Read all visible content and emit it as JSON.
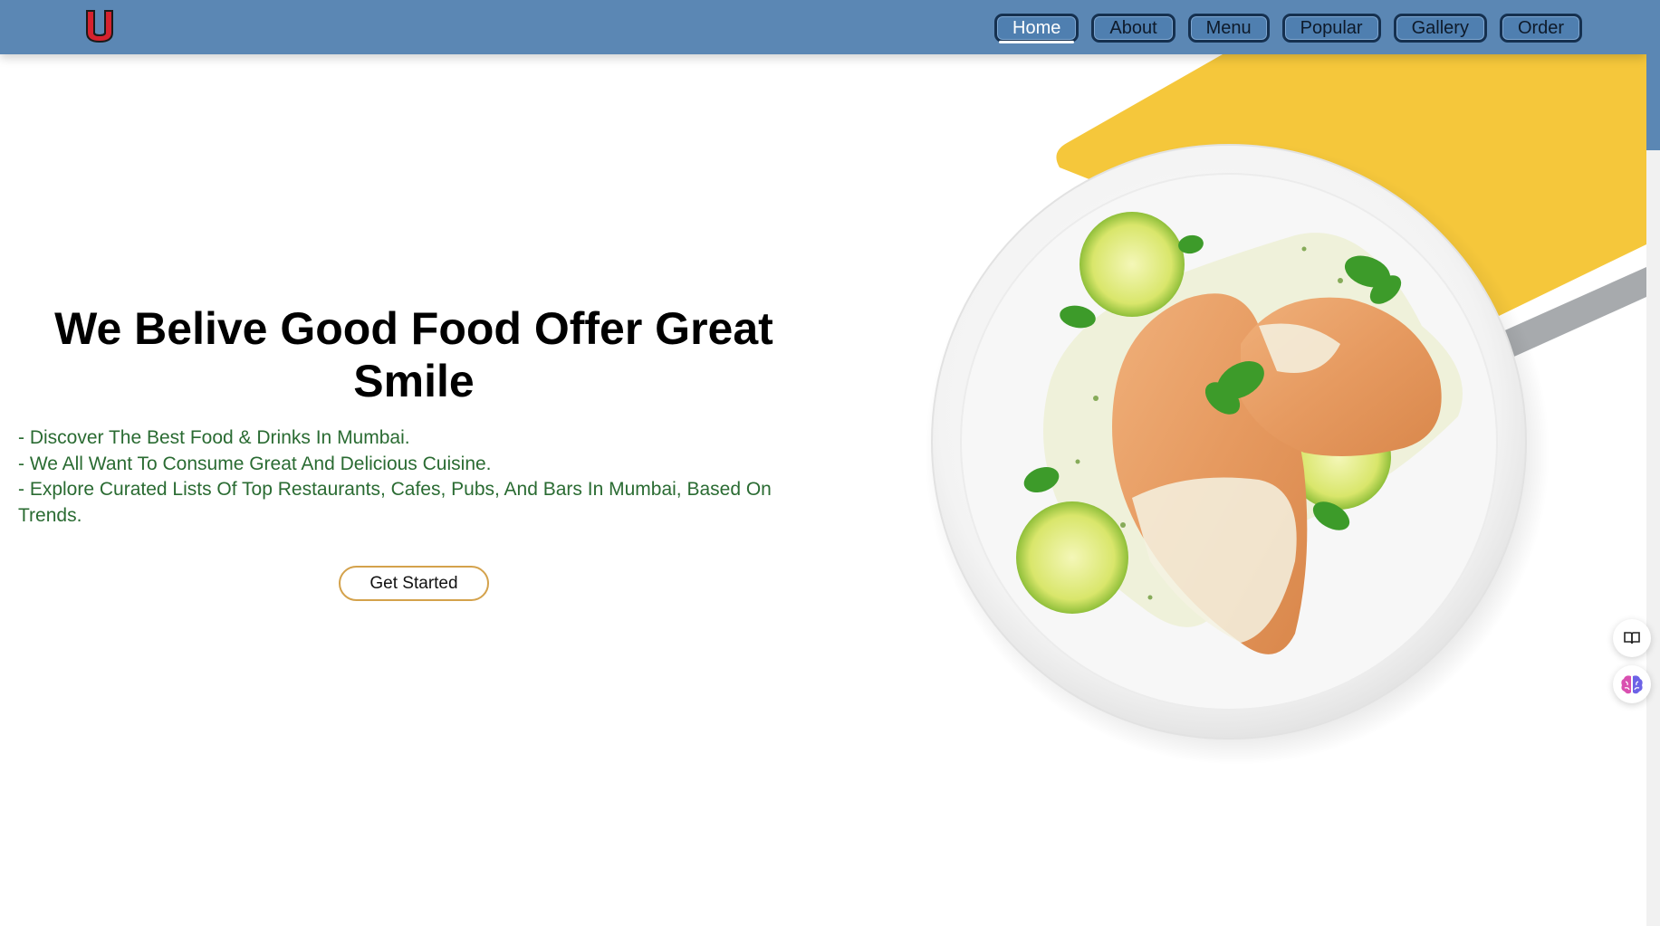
{
  "nav": {
    "items": [
      {
        "label": "Home",
        "active": true
      },
      {
        "label": "About",
        "active": false
      },
      {
        "label": "Menu",
        "active": false
      },
      {
        "label": "Popular",
        "active": false
      },
      {
        "label": "Gallery",
        "active": false
      },
      {
        "label": "Order",
        "active": false
      }
    ]
  },
  "hero": {
    "title": "We Belive Good Food Offer Great Smile",
    "points": [
      "- Discover The Best Food & Drinks In Mumbai.",
      "- We All Want To Consume Great And Delicious Cuisine.",
      "- Explore Curated Lists Of Top Restaurants, Cafes, Pubs, And Bars In Mumbai, Based On Trends."
    ],
    "cta_label": "Get Started"
  },
  "icons": {
    "logo": "u-logo-icon",
    "reader": "book-reader-icon",
    "assistant": "brain-icon"
  },
  "colors": {
    "header_bg": "#5b87b4",
    "nav_border": "#15304f",
    "title_text": "#000000",
    "list_text": "#2a6b32",
    "cta_border": "#d4a24c",
    "accent_yellow": "#f5c73b",
    "accent_grey": "#a7aaad",
    "logo_red": "#d6222e"
  }
}
